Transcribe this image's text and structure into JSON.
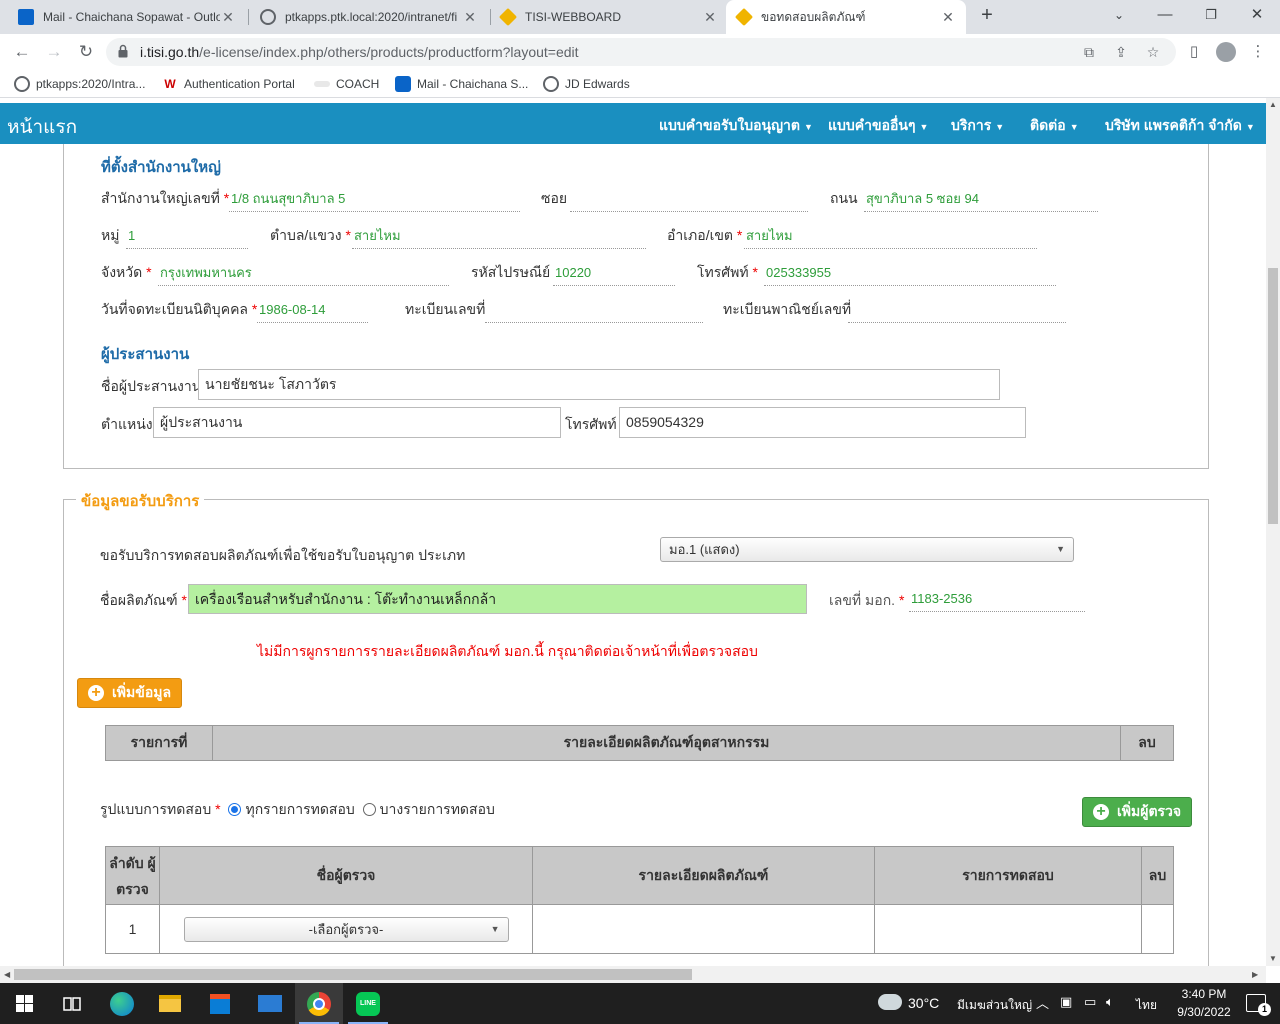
{
  "browser": {
    "tabs": [
      {
        "title": "Mail - Chaichana Sopawat - Outlo",
        "icon": "outlook-icon"
      },
      {
        "title": "ptkapps.ptk.local:2020/intranet/fi",
        "icon": "globe-icon"
      },
      {
        "title": "TISI-WEBBOARD",
        "icon": "tisi-icon"
      },
      {
        "title": "ขอทดสอบผลิตภัณฑ์",
        "icon": "tisi-icon"
      }
    ],
    "url_domain": "i.tisi.go.th",
    "url_path": "/e-license/index.php/others/products/productform?layout=edit",
    "bookmarks": [
      {
        "label": "ptkapps:2020/Intra...",
        "icon": "globe-icon"
      },
      {
        "label": "Authentication Portal",
        "icon": "w-icon"
      },
      {
        "label": "COACH",
        "icon": "coach-icon"
      },
      {
        "label": "Mail - Chaichana S...",
        "icon": "outlook-icon"
      },
      {
        "label": "JD Edwards",
        "icon": "globe-icon"
      }
    ]
  },
  "site": {
    "brand": "หน้าแรก",
    "menu": [
      "แบบคำขอรับใบอนุญาต",
      "แบบคำขออื่นๆ",
      "บริการ",
      "ติดต่อ",
      "บริษัท แพรคติก้า จำกัด"
    ]
  },
  "head_office": {
    "title": "ที่ตั้งสำนักงานใหญ่",
    "address_no_label": "สำนักงานใหญ่เลขที่",
    "address_no": "1/8 ถนนสุขาภิบาล 5",
    "soi_label": "ซอย",
    "soi": "",
    "road_label": "ถนน",
    "road": "สุขาภิบาล 5 ซอย 94",
    "moo_label": "หมู่",
    "moo": "1",
    "subdistrict_label": "ตำบล/แขวง",
    "subdistrict": "สายไหม",
    "district_label": "อำเภอ/เขต",
    "district": "สายไหม",
    "province_label": "จังหวัด",
    "province": "กรุงเทพมหานคร",
    "zipcode_label": "รหัสไปรษณีย์",
    "zipcode": "10220",
    "phone_label": "โทรศัพท์",
    "phone": "025333955",
    "reg_date_label": "วันที่จดทะเบียนนิติบุคคล",
    "reg_date": "1986-08-14",
    "reg_no_label": "ทะเบียนเลขที่",
    "reg_no": "",
    "commerce_no_label": "ทะเบียนพาณิชย์เลขที่",
    "commerce_no": ""
  },
  "coordinator": {
    "title": "ผู้ประสานงาน",
    "name_label": "ชื่อผู้ประสานงาน",
    "name": "นายชัยชนะ โสภาวัตร",
    "position_label": "ตำแหน่ง",
    "position": "ผู้ประสานงาน",
    "phone_label": "โทรศัพท์",
    "phone": "0859054329"
  },
  "service": {
    "legend": "ข้อมูลขอรับบริการ",
    "type_label": "ขอรับบริการทดสอบผลิตภัณฑ์เพื่อใช้ขอรับใบอนุญาต ประเภท",
    "type_value": "มอ.1 (แสดง)",
    "product_label": "ชื่อผลิตภัณฑ์",
    "product_value": "เครื่องเรือนสำหรับสำนักงาน : โต๊ะทำงานเหล็กกล้า",
    "tis_label": "เลขที่ มอก.",
    "tis_value": "1183-2536",
    "error": "ไม่มีการผูกรายการรายละเอียดผลิตภัณฑ์ มอก.นี้ กรุณาติดต่อเจ้าหน้าที่เพื่อตรวจสอบ",
    "add_button": "เพิ่มข้อมูล",
    "detail_table": {
      "headers": [
        "รายการที่",
        "รายละเอียดผลิตภัณฑ์อุตสาหกรรม",
        "ลบ"
      ]
    },
    "test_mode_label": "รูปแบบการทดสอบ",
    "test_mode_options": [
      "ทุกรายการทดสอบ",
      "บางรายการทดสอบ"
    ],
    "add_inspector_button": "เพิ่มผู้ตรวจ",
    "inspector_table": {
      "headers": [
        "ลำดับ ผู้ตรวจ",
        "ชื่อผู้ตรวจ",
        "รายละเอียดผลิตภัณฑ์",
        "รายการทดสอบ",
        "ลบ"
      ],
      "rows": [
        {
          "no": "1",
          "select": "-เลือกผู้ตรวจ-"
        }
      ]
    }
  },
  "taskbar": {
    "weather": "30°C",
    "weather_text": "มีเมฆส่วนใหญ่",
    "lang": "ไทย",
    "time": "3:40 PM",
    "date": "9/30/2022",
    "notif_count": "1"
  }
}
